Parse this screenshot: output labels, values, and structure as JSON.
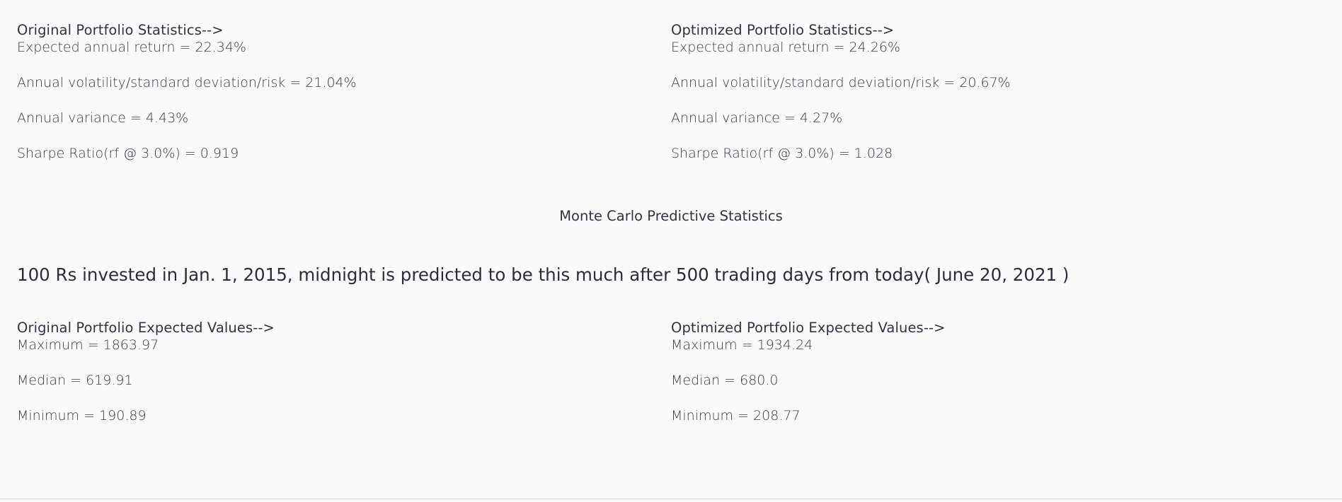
{
  "original_stats": {
    "title": "Original Portfolio Statistics-->",
    "expected_return": "Expected annual return = 22.34%",
    "volatility": "Annual volatility/standard deviation/risk = 21.04%",
    "variance": "Annual variance = 4.43%",
    "sharpe": "Sharpe Ratio(rf @ 3.0%) = 0.919"
  },
  "optimized_stats": {
    "title": "Optimized Portfolio Statistics-->",
    "expected_return": "Expected annual return = 24.26%",
    "volatility": "Annual volatility/standard deviation/risk = 20.67%",
    "variance": "Annual variance = 4.27%",
    "sharpe": "Sharpe Ratio(rf @ 3.0%) = 1.028"
  },
  "monte_carlo": {
    "title": "Monte Carlo Predictive Statistics",
    "headline": "100 Rs invested in Jan. 1, 2015, midnight is predicted to be this much after 500 trading days from today( June 20, 2021 )"
  },
  "original_expected": {
    "title": "Original Portfolio Expected Values-->",
    "maximum": "Maximum = 1863.97",
    "median": "Median = 619.91",
    "minimum": "Minimum = 190.89"
  },
  "optimized_expected": {
    "title": "Optimized Portfolio Expected Values-->",
    "maximum": "Maximum = 1934.24",
    "median": "Median = 680.0",
    "minimum": "Minimum = 208.77"
  }
}
